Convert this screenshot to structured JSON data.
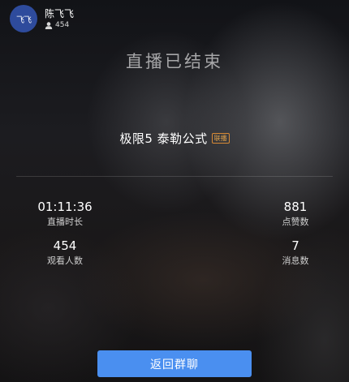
{
  "host": {
    "avatar_text": "飞飞",
    "name": "陈飞飞",
    "viewer_count": "454",
    "viewer_icon": "person-icon"
  },
  "end_title": "直播已结束",
  "course": {
    "title": "极限5 泰勒公式",
    "tag": "联播",
    "tag_color": "#d98a35"
  },
  "stats": {
    "duration": {
      "value": "01:11:36",
      "label": "直播时长"
    },
    "likes": {
      "value": "881",
      "label": "点赞数"
    },
    "viewers": {
      "value": "454",
      "label": "观看人数"
    },
    "messages": {
      "value": "7",
      "label": "消息数"
    }
  },
  "back_button": {
    "label": "返回群聊",
    "color": "#4a8ff0"
  }
}
